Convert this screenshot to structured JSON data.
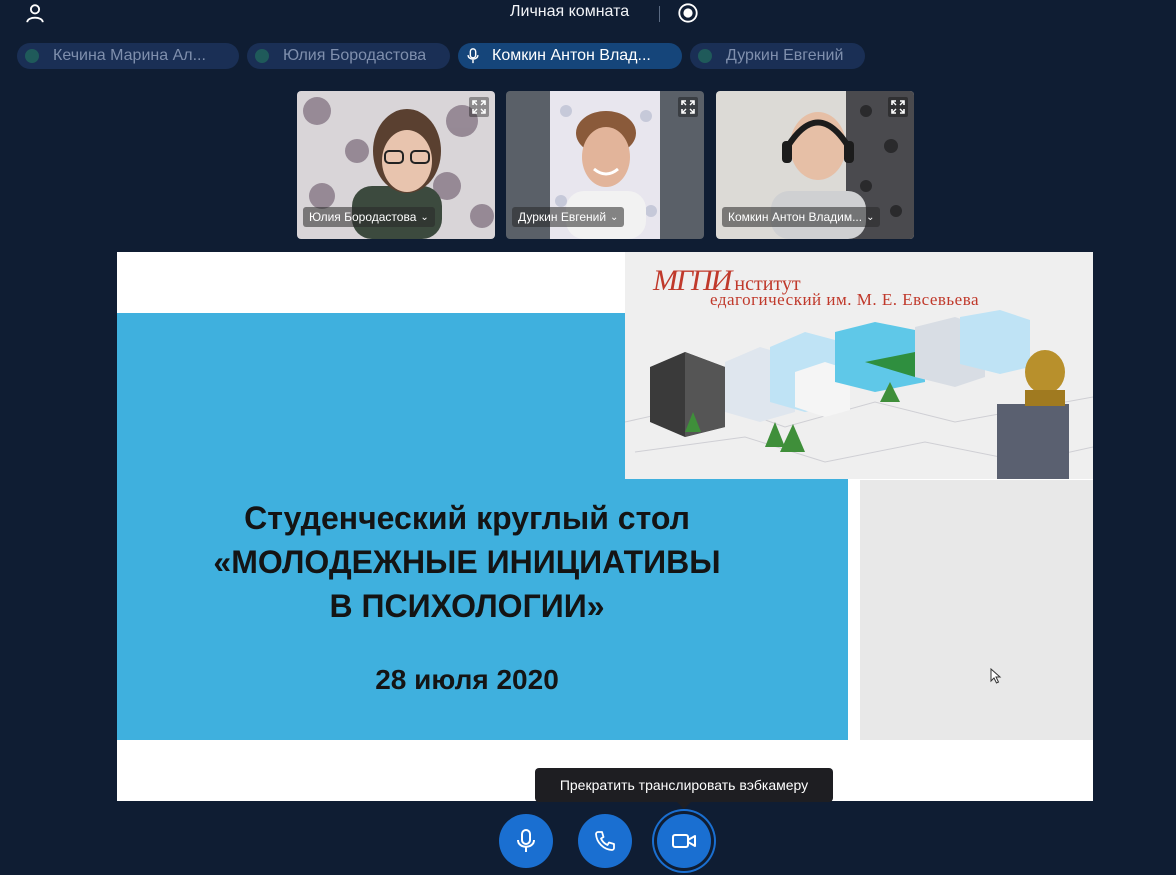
{
  "header": {
    "room_title": "Личная комната",
    "icons": [
      "user-icon",
      "record-icon"
    ]
  },
  "participants": [
    {
      "name": "Кечина Марина Ал...",
      "active": false
    },
    {
      "name": "Юлия Бородастова",
      "active": false
    },
    {
      "name": "Комкин Антон Влад...",
      "active": true
    },
    {
      "name": "Дуркин Евгений",
      "active": false
    }
  ],
  "tiles": [
    {
      "label": "Юлия Бородастова"
    },
    {
      "label": "Дуркин Евгений"
    },
    {
      "label": "Комкин Антон Владим..."
    }
  ],
  "slide": {
    "logo_mark": "МГПИ",
    "logo_line1": "нститут",
    "logo_line2": "едагогический им. М. Е. Евсевьева",
    "title_line1": "Студенческий круглый стол",
    "title_line2": "«МОЛОДЕЖНЫЕ ИНИЦИАТИВЫ",
    "title_line3": "В ПСИХОЛОГИИ»",
    "date": "28 июля 2020"
  },
  "controls": {
    "tooltip": "Прекратить транслировать вэбкамеру",
    "buttons": [
      "microphone-icon",
      "phone-icon",
      "camera-icon"
    ]
  },
  "colors": {
    "background": "#0f1d33",
    "accent": "#1a6fd1",
    "slide_blue": "#3fb0de"
  }
}
